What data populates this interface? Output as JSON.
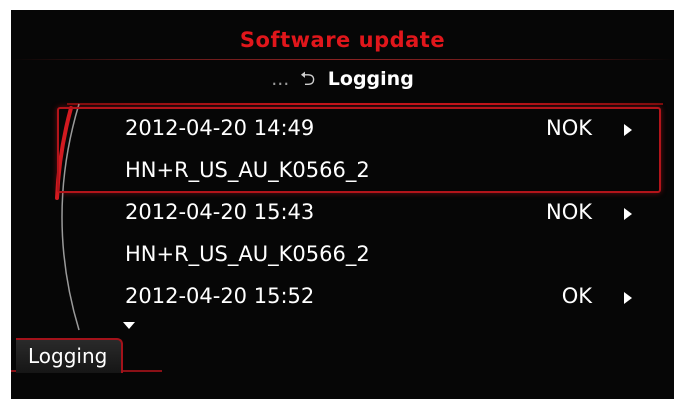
{
  "screen": {
    "title": "Software update",
    "breadcrumb": {
      "prefix": "...",
      "back_icon": "back-arrow-icon",
      "label": "Logging"
    }
  },
  "log_entries": [
    {
      "datetime": "2012-04-20 14:49",
      "status": "NOK",
      "file": "HN+R_US_AU_K0566_2",
      "selected": true
    },
    {
      "datetime": "2012-04-20 15:43",
      "status": "NOK",
      "file": "HN+R_US_AU_K0566_2",
      "selected": false
    },
    {
      "datetime": "2012-04-20 15:52",
      "status": "OK",
      "file": null,
      "selected": false
    }
  ],
  "bottom_tab": {
    "label": "Logging"
  },
  "colors": {
    "accent": "#e0161b",
    "background": "#060606",
    "text": "#ffffff"
  }
}
